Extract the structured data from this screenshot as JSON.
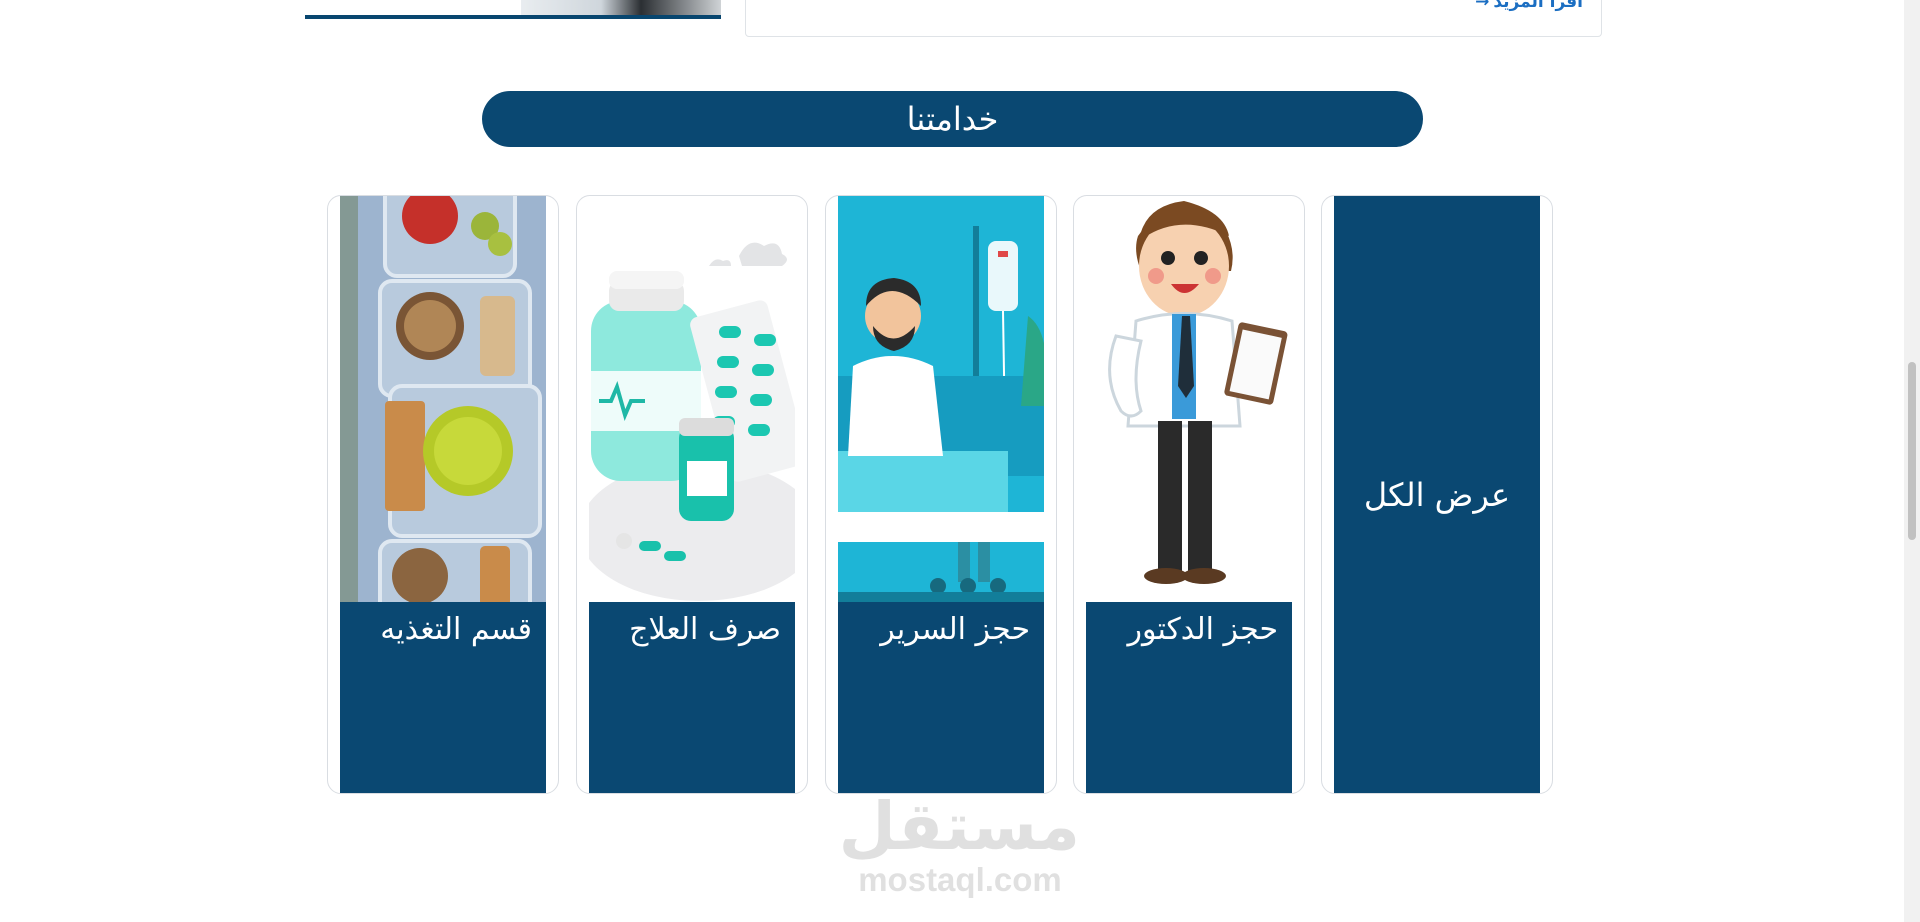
{
  "top": {
    "read_more": "اقرأ المزيد",
    "read_more_arrow": "→"
  },
  "services": {
    "title": "خدامتنا"
  },
  "cards": [
    {
      "label": "قسم التغذيه",
      "image": "food-icon"
    },
    {
      "label": "صرف العلاج",
      "image": "medicine-icon"
    },
    {
      "label": "حجز السرير",
      "image": "hospital-bed-icon"
    },
    {
      "label": "حجز الدكتور",
      "image": "doctor-icon"
    }
  ],
  "view_all": {
    "label": "عرض الكل"
  },
  "watermark": {
    "ar": "مستقل",
    "en": "mostaql.com"
  },
  "colors": {
    "primary": "#0a4872",
    "link": "#1b6ec2",
    "border": "#d9dde2"
  }
}
